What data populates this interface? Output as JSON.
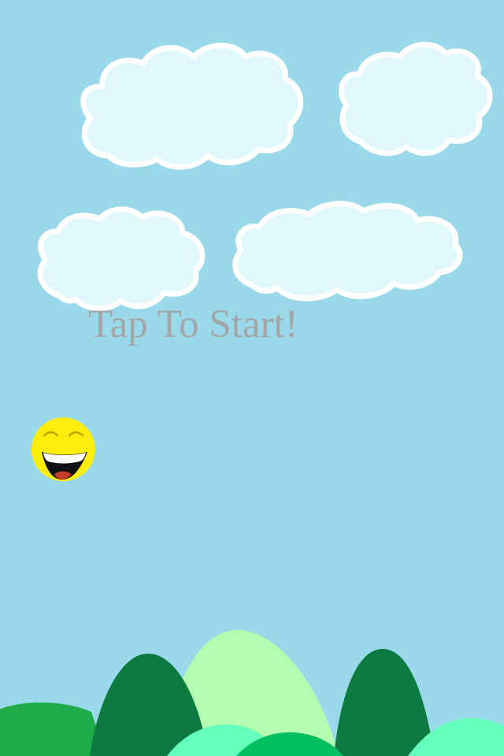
{
  "game": {
    "start_prompt": "Tap To Start!",
    "sky_color": "#9ad9e9",
    "cloud_fill": "#e0f8fc",
    "cloud_outline": "#ffffff",
    "text_color": "#a2a6a7",
    "player_color": "#ffed0c",
    "hill_colors": {
      "dark_green": "#0d7a40",
      "medium_green": "#20ab49",
      "pale_green": "#b2fdb0",
      "mint": "#65ffbd",
      "emerald": "#00c061"
    }
  }
}
